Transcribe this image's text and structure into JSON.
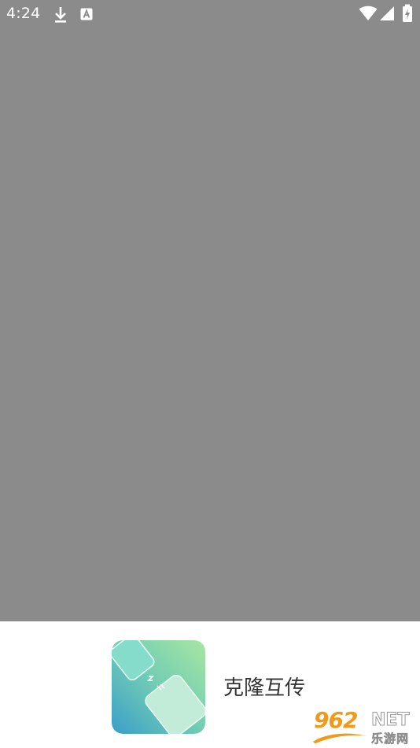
{
  "status_bar": {
    "time": "4:24",
    "icons": [
      "download-icon",
      "keyboard-a-icon",
      "wifi-icon",
      "signal-icon",
      "battery-charging-icon"
    ]
  },
  "app": {
    "name": "克隆互传",
    "logo_icon": "clone-transfer-logo-icon"
  },
  "watermark": {
    "number": "962",
    "suffix": "NET",
    "site_name": "乐游网"
  },
  "colors": {
    "splash_background": "#8b8b8b",
    "panel_background": "#ffffff",
    "logo_gradient_top": "#a8e6a2",
    "logo_gradient_bottom": "#3a9ec9",
    "watermark_orange": "#f19a1a"
  }
}
